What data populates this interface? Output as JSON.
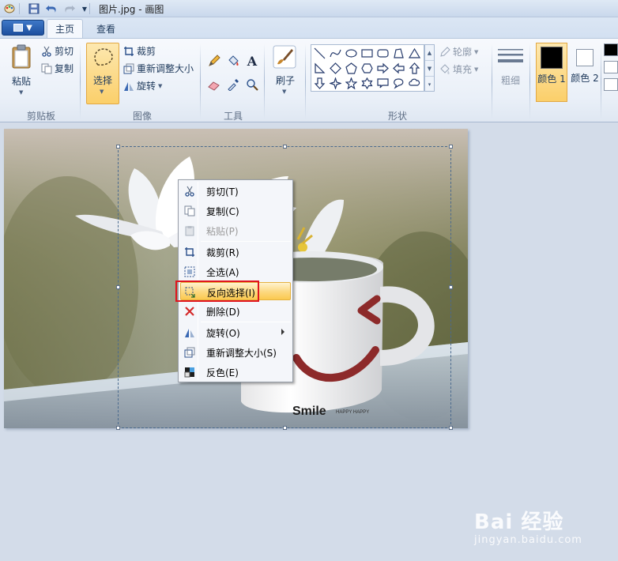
{
  "titlebar": {
    "title": "图片.jpg - 画图"
  },
  "tabs": [
    {
      "label": "主页",
      "active": true
    },
    {
      "label": "查看",
      "active": false
    }
  ],
  "ribbon": {
    "clipboard": {
      "paste": "粘贴",
      "cut": "剪切",
      "copy": "复制",
      "group": "剪贴板"
    },
    "image": {
      "select": "选择",
      "crop": "裁剪",
      "resize": "重新调整大小",
      "rotate": "旋转",
      "group": "图像"
    },
    "tools": {
      "group": "工具",
      "text_glyph": "A"
    },
    "brushes": {
      "label": "刷子"
    },
    "shapes": {
      "outline": "轮廓",
      "fill": "填充",
      "group": "形状"
    },
    "size": {
      "label": "粗细"
    },
    "colors": {
      "color1": "颜色 1",
      "color2": "颜色 2",
      "color1_value": "#000000",
      "color2_value": "#ffffff"
    }
  },
  "context_menu": {
    "items": [
      {
        "label": "剪切(T)",
        "icon": "scissors-icon",
        "enabled": true
      },
      {
        "label": "复制(C)",
        "icon": "copy-icon",
        "enabled": true
      },
      {
        "label": "粘贴(P)",
        "icon": "paste-icon",
        "enabled": false
      },
      {
        "label": "裁剪(R)",
        "icon": "crop-icon",
        "enabled": true
      },
      {
        "label": "全选(A)",
        "icon": "select-all-icon",
        "enabled": true
      },
      {
        "label": "反向选择(I)",
        "icon": "invert-selection-icon",
        "enabled": true,
        "highlighted": true
      },
      {
        "label": "删除(D)",
        "icon": "delete-icon",
        "enabled": true
      },
      {
        "label": "旋转(O)",
        "icon": "rotate-icon",
        "enabled": true,
        "submenu": true
      },
      {
        "label": "重新调整大小(S)",
        "icon": "resize-icon",
        "enabled": true
      },
      {
        "label": "反色(E)",
        "icon": "invert-color-icon",
        "enabled": true
      }
    ]
  },
  "photo": {
    "mug_text": "Smile",
    "mug_subtext": "HAPPY HAPPY"
  },
  "watermark": {
    "brand": "Bai 经验",
    "url": "jingyan.baidu.com"
  },
  "accent_colors": {
    "highlight": "#fbc94f",
    "annotation_box": "#e0141e",
    "app_menu": "#2b62b4"
  }
}
